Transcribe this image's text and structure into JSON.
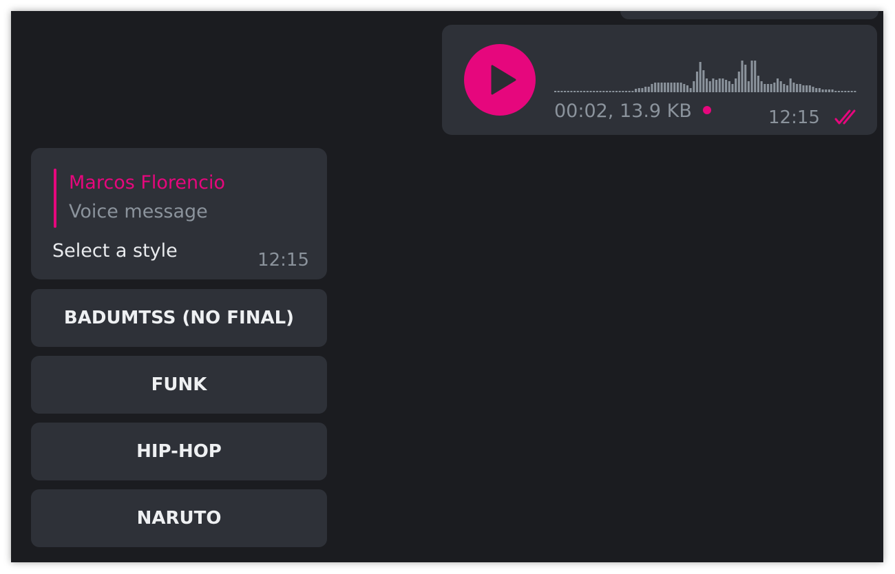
{
  "outgoing_voice": {
    "meta": "00:02, 13.9 KB",
    "time": "12:15",
    "status_icon": "double-check-icon"
  },
  "incoming": {
    "reply_author": "Marcos Florencio",
    "reply_preview": "Voice message",
    "text": "Select a style",
    "time": "12:15"
  },
  "keyboard": {
    "buttons": [
      {
        "label": "BADUMTSS (NO FINAL)"
      },
      {
        "label": "FUNK"
      },
      {
        "label": "HIP-HOP"
      },
      {
        "label": "NARUTO"
      }
    ]
  },
  "colors": {
    "accent": "#e6077d",
    "background": "#1b1c20",
    "bubble": "#2e3138",
    "muted_text": "#8b939c"
  }
}
